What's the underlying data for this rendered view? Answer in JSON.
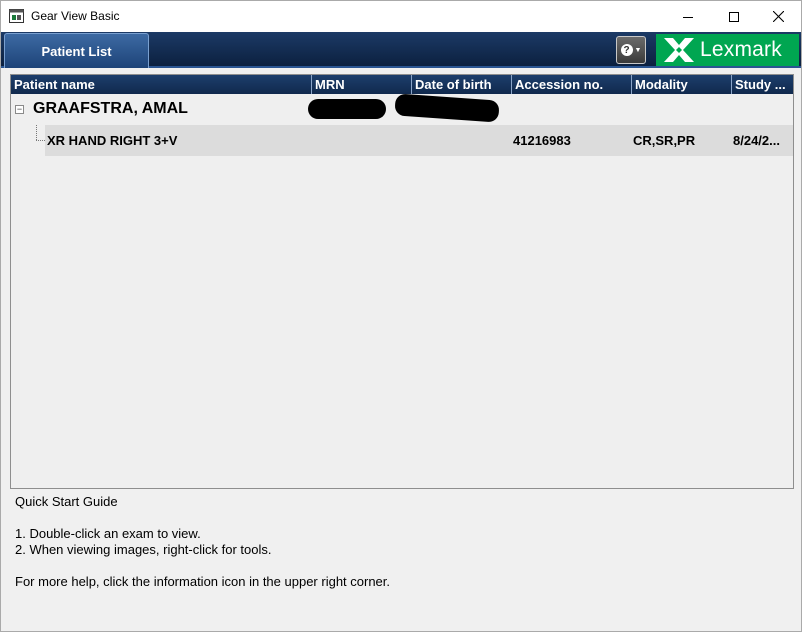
{
  "window": {
    "title": "Gear View Basic"
  },
  "toolbar": {
    "tab_label": "Patient List",
    "help_glyph": "?",
    "brand": "Lexmark",
    "brand_color": "#00a651"
  },
  "table": {
    "columns": [
      "Patient name",
      "MRN",
      "Date of birth",
      "Accession no.",
      "Modality",
      "Study ..."
    ],
    "patient": {
      "name": "GRAAFSTRA, AMAL",
      "mrn": "",
      "dob": ""
    },
    "exams": [
      {
        "description": "XR HAND RIGHT 3+V",
        "accession": "41216983",
        "modality": "CR,SR,PR",
        "study_date": "8/24/2..."
      }
    ]
  },
  "quick_start": {
    "title": "Quick Start Guide",
    "step1": "1. Double-click an exam to view.",
    "step2": "2. When viewing images, right-click for tools.",
    "footer": "For more help, click the information icon in the upper right corner."
  }
}
